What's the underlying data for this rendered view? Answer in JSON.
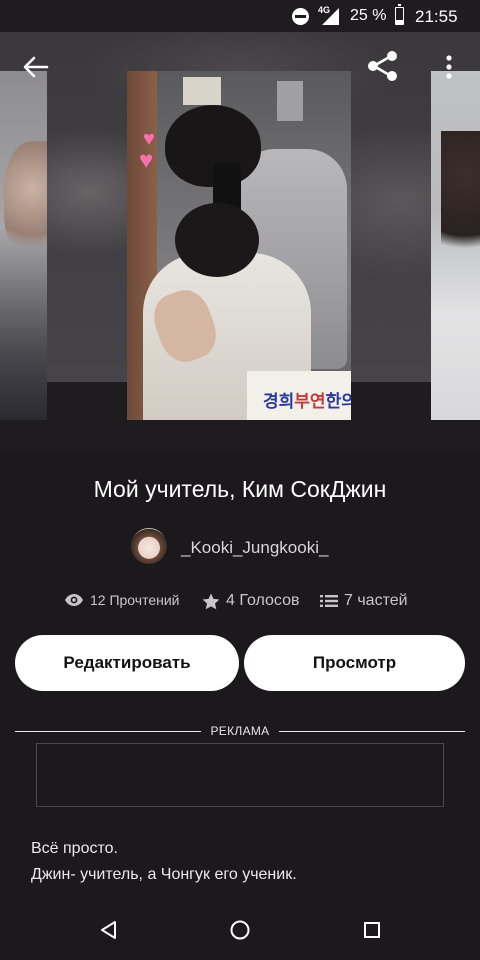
{
  "status_bar": {
    "network": "4G",
    "battery_text": "25 %",
    "battery_level": 0.25,
    "time": "21:55",
    "icons": [
      "do-not-disturb-icon",
      "signal-icon",
      "battery-icon"
    ]
  },
  "top_bar": {
    "back_icon": "arrow-left-icon",
    "share_icon": "share-icon",
    "more_icon": "more-vertical-icon"
  },
  "story": {
    "title": "Мой учитель, Ким СокДжин",
    "author": "_Kooki_Jungkooki_",
    "cover_banner_text_blue": "경희",
    "cover_banner_text_red": "부연",
    "cover_banner_text_blue2": "한의",
    "stats": {
      "reads": "12 Прочтений",
      "votes": "4 Голосов",
      "parts": "7 частей"
    },
    "description_lines": [
      "Всё просто.",
      "Джин- учитель, а Чонгук его ученик."
    ]
  },
  "actions": {
    "edit_label": "Редактировать",
    "view_label": "Просмотр"
  },
  "ad": {
    "label": "РЕКЛАМА"
  },
  "colors": {
    "background": "#1b191c",
    "button_bg": "#ffffff",
    "button_text": "#121212",
    "secondary_text": "#c8c6c9"
  }
}
